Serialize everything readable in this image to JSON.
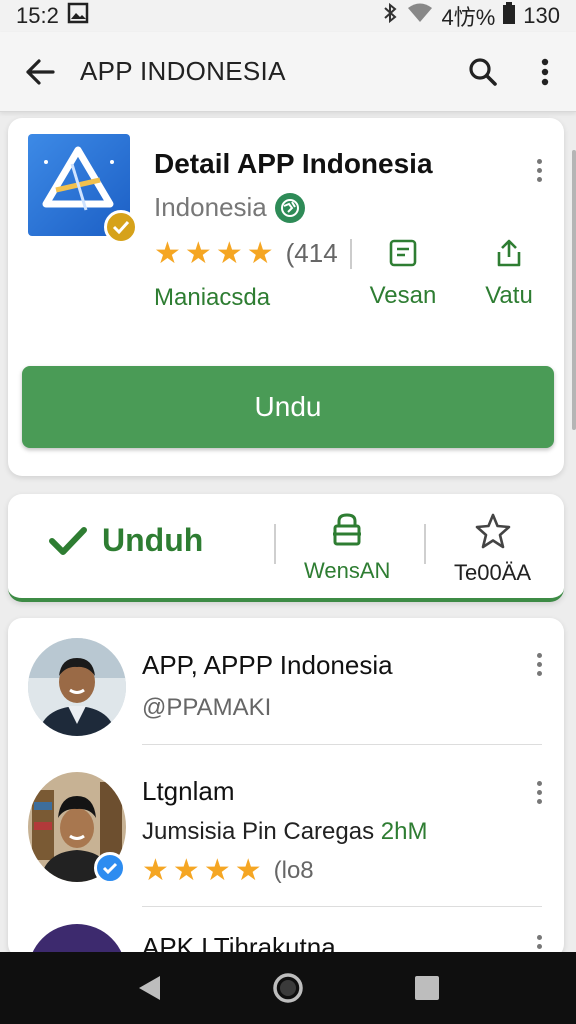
{
  "status_bar": {
    "time": "15:2",
    "battery_text": "4㤃%",
    "signal_text": "130"
  },
  "app_bar": {
    "title": "APP INDONESIA"
  },
  "app_detail": {
    "title": "Detail APP Indonesia",
    "subtitle": "Indonesia",
    "rating_count": "(414",
    "developer": "Maniacsda",
    "action_1_label": "Vesan",
    "action_2_label": "Vatu",
    "install_label": "Undu",
    "rating_stars": 4
  },
  "actions_bar": {
    "unduh_label": "Unduh",
    "action_2_label": "WensAN",
    "action_3_label": "Te00ÄA"
  },
  "list": {
    "item1": {
      "title": "APP, APPP Indonesia",
      "handle": "@PPAMAKI"
    },
    "item2": {
      "title": "Ltgnlam",
      "subtitle_prefix": "Jumsisia Pin Caregas",
      "subtitle_highlight": "2hM",
      "rating_count": "(lo8",
      "rating_stars": 4
    },
    "item3": {
      "title": "APK LTihrakutna"
    }
  },
  "colors": {
    "accent_green": "#4a9b56",
    "dark_green": "#2e7d32",
    "star": "#f5a623",
    "badge_gold": "#d6a21a",
    "verify_blue": "#2d8cf0"
  }
}
